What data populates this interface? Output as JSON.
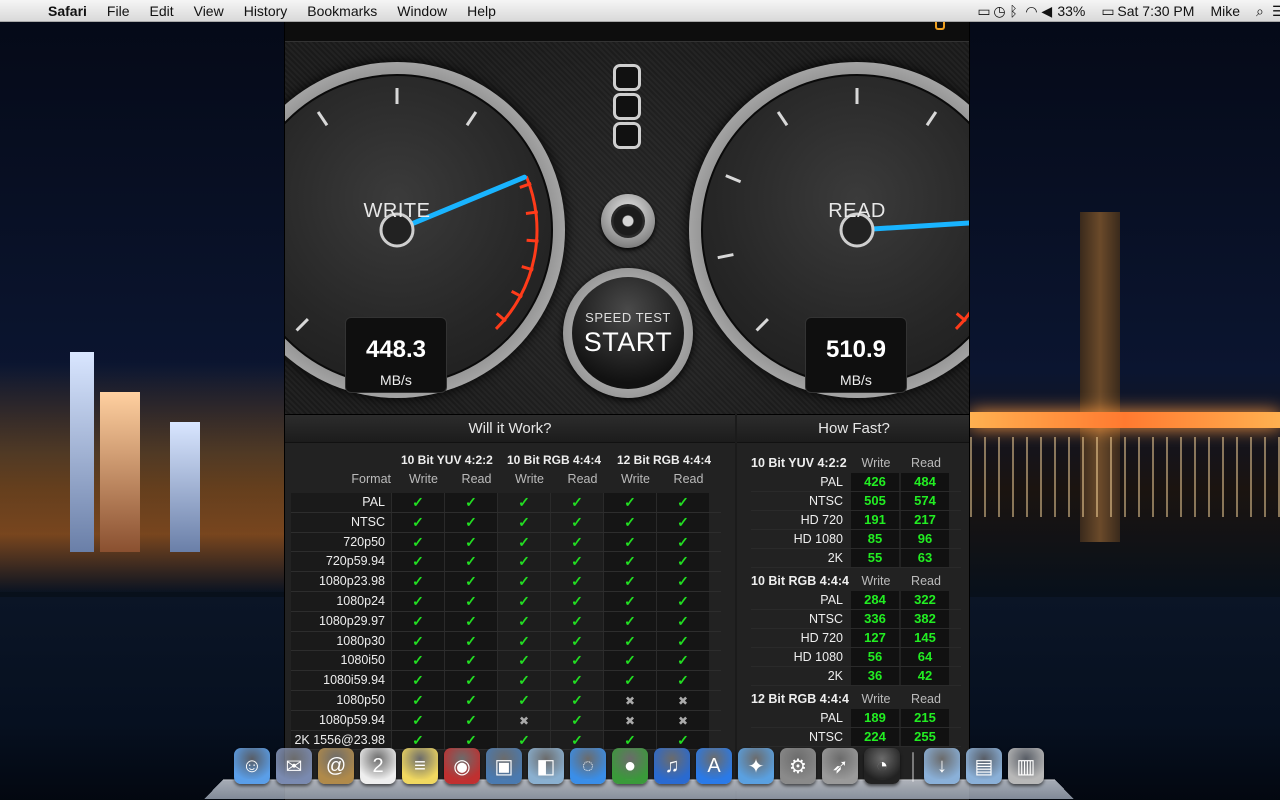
{
  "menubar": {
    "app_name": "Safari",
    "items": [
      "File",
      "Edit",
      "View",
      "History",
      "Bookmarks",
      "Window",
      "Help"
    ],
    "battery": "33%",
    "clock": "Sat 7:30 PM",
    "user": "Mike"
  },
  "gauges": {
    "write": {
      "label": "WRITE",
      "value": "448.3",
      "unit": "MB/s",
      "level": 0.75
    },
    "read": {
      "label": "READ",
      "value": "510.9",
      "unit": "MB/s",
      "level": 0.82
    }
  },
  "start_button": {
    "small": "SPEED TEST",
    "big": "START"
  },
  "will_it_work": {
    "title": "Will it Work?",
    "format_header": "Format",
    "groups": [
      "10 Bit YUV 4:2:2",
      "10 Bit RGB 4:4:4",
      "12 Bit RGB 4:4:4"
    ],
    "col_labels": [
      "Write",
      "Read",
      "Write",
      "Read",
      "Write",
      "Read"
    ],
    "rows": [
      {
        "format": "PAL",
        "r": [
          1,
          1,
          1,
          1,
          1,
          1
        ]
      },
      {
        "format": "NTSC",
        "r": [
          1,
          1,
          1,
          1,
          1,
          1
        ]
      },
      {
        "format": "720p50",
        "r": [
          1,
          1,
          1,
          1,
          1,
          1
        ]
      },
      {
        "format": "720p59.94",
        "r": [
          1,
          1,
          1,
          1,
          1,
          1
        ]
      },
      {
        "format": "1080p23.98",
        "r": [
          1,
          1,
          1,
          1,
          1,
          1
        ]
      },
      {
        "format": "1080p24",
        "r": [
          1,
          1,
          1,
          1,
          1,
          1
        ]
      },
      {
        "format": "1080p29.97",
        "r": [
          1,
          1,
          1,
          1,
          1,
          1
        ]
      },
      {
        "format": "1080p30",
        "r": [
          1,
          1,
          1,
          1,
          1,
          1
        ]
      },
      {
        "format": "1080i50",
        "r": [
          1,
          1,
          1,
          1,
          1,
          1
        ]
      },
      {
        "format": "1080i59.94",
        "r": [
          1,
          1,
          1,
          1,
          1,
          1
        ]
      },
      {
        "format": "1080p50",
        "r": [
          1,
          1,
          1,
          1,
          0,
          0
        ]
      },
      {
        "format": "1080p59.94",
        "r": [
          1,
          1,
          0,
          1,
          0,
          0
        ]
      },
      {
        "format": "2K 1556@23.98",
        "r": [
          1,
          1,
          1,
          1,
          1,
          1
        ]
      }
    ]
  },
  "how_fast": {
    "title": "How Fast?",
    "write_label": "Write",
    "read_label": "Read",
    "groups": [
      {
        "name": "10 Bit YUV 4:2:2",
        "rows": [
          {
            "format": "PAL",
            "write": "426",
            "read": "484"
          },
          {
            "format": "NTSC",
            "write": "505",
            "read": "574"
          },
          {
            "format": "HD 720",
            "write": "191",
            "read": "217"
          },
          {
            "format": "HD 1080",
            "write": "85",
            "read": "96"
          },
          {
            "format": "2K",
            "write": "55",
            "read": "63"
          }
        ]
      },
      {
        "name": "10 Bit RGB 4:4:4",
        "rows": [
          {
            "format": "PAL",
            "write": "284",
            "read": "322"
          },
          {
            "format": "NTSC",
            "write": "336",
            "read": "382"
          },
          {
            "format": "HD 720",
            "write": "127",
            "read": "145"
          },
          {
            "format": "HD 1080",
            "write": "56",
            "read": "64"
          },
          {
            "format": "2K",
            "write": "36",
            "read": "42"
          }
        ]
      },
      {
        "name": "12 Bit RGB 4:4:4",
        "rows": [
          {
            "format": "PAL",
            "write": "189",
            "read": "215"
          },
          {
            "format": "NTSC",
            "write": "224",
            "read": "255"
          }
        ]
      }
    ]
  },
  "dock": {
    "apps": [
      {
        "icon": "finder-icon",
        "color": "#5a9ee8"
      },
      {
        "icon": "mail-stamp-icon",
        "color": "#7a8ab0"
      },
      {
        "icon": "contacts-icon",
        "color": "#b08a4a"
      },
      {
        "icon": "calendar-icon",
        "color": "#eeeeee"
      },
      {
        "icon": "notes-icon",
        "color": "#f0d860"
      },
      {
        "icon": "photo-booth-icon",
        "color": "#c03030"
      },
      {
        "icon": "iphoto-icon",
        "color": "#4a7ab0"
      },
      {
        "icon": "preview-icon",
        "color": "#8ab0d0"
      },
      {
        "icon": "messages-icon",
        "color": "#3a8ee8"
      },
      {
        "icon": "facetime-icon",
        "color": "#3a9a3a"
      },
      {
        "icon": "itunes-icon",
        "color": "#2a6ad0"
      },
      {
        "icon": "app-store-icon",
        "color": "#2a7ae8"
      },
      {
        "icon": "safari-icon",
        "color": "#5aa0e0"
      },
      {
        "icon": "system-preferences-icon",
        "color": "#8a8a8a"
      },
      {
        "icon": "launchpad-icon",
        "color": "#9a9a9a"
      },
      {
        "icon": "disk-speed-test-icon",
        "color": "#222222"
      }
    ],
    "trash_items": [
      {
        "icon": "downloads-folder-icon",
        "color": "#8ab0d8"
      },
      {
        "icon": "documents-folder-icon",
        "color": "#8ab0d8"
      },
      {
        "icon": "trash-icon",
        "color": "#b8b8b8"
      }
    ]
  },
  "colors": {
    "needle": "#19b4ff",
    "redline": "#ff3b1a",
    "ok_green": "#22dd22"
  }
}
